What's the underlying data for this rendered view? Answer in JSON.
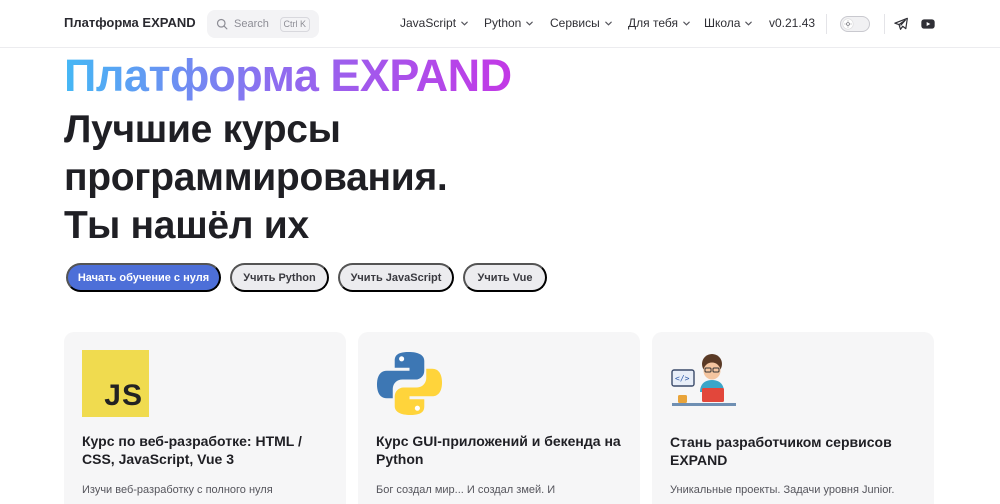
{
  "nav": {
    "brand": "Платформа EXPAND",
    "search_label": "Search",
    "search_shortcut": "Ctrl K",
    "menu": [
      {
        "label": "JavaScript"
      },
      {
        "label": "Python"
      },
      {
        "label": "Сервисы"
      },
      {
        "label": "Для тебя"
      },
      {
        "label": "Школа"
      }
    ],
    "version": "v0.21.43",
    "icons": [
      "search-icon",
      "chevron-down-icon",
      "sun-icon",
      "telegram-icon",
      "youtube-icon"
    ]
  },
  "hero": {
    "brand": "Платформа EXPAND",
    "title_lines": [
      "Лучшие курсы",
      "программирования.",
      "Ты нашёл их"
    ],
    "gradient_colors": [
      "#45b8f5",
      "#8c6ff0",
      "#c338e6"
    ]
  },
  "actions": [
    {
      "label": "Начать обучение с нуля"
    },
    {
      "label": "Учить Python"
    },
    {
      "label": "Учить JavaScript"
    },
    {
      "label": "Учить Vue"
    }
  ],
  "accent_color": "#4d6fd8",
  "cards": [
    {
      "icon": "javascript-logo-icon",
      "logo_text": "JS",
      "title": "Курс по веб-разработке: HTML / CSS, JavaScript, Vue 3",
      "desc": "Изучи веб-разработку с полного нуля"
    },
    {
      "icon": "python-logo-icon",
      "title": "Курс GUI-приложений и бекенда на Python",
      "desc": "Бог создал мир... И создал змей. И"
    },
    {
      "icon": "developer-illustration-icon",
      "title": "Стань разработчиком сервисов EXPAND",
      "desc": "Уникальные проекты. Задачи уровня Junior."
    }
  ]
}
